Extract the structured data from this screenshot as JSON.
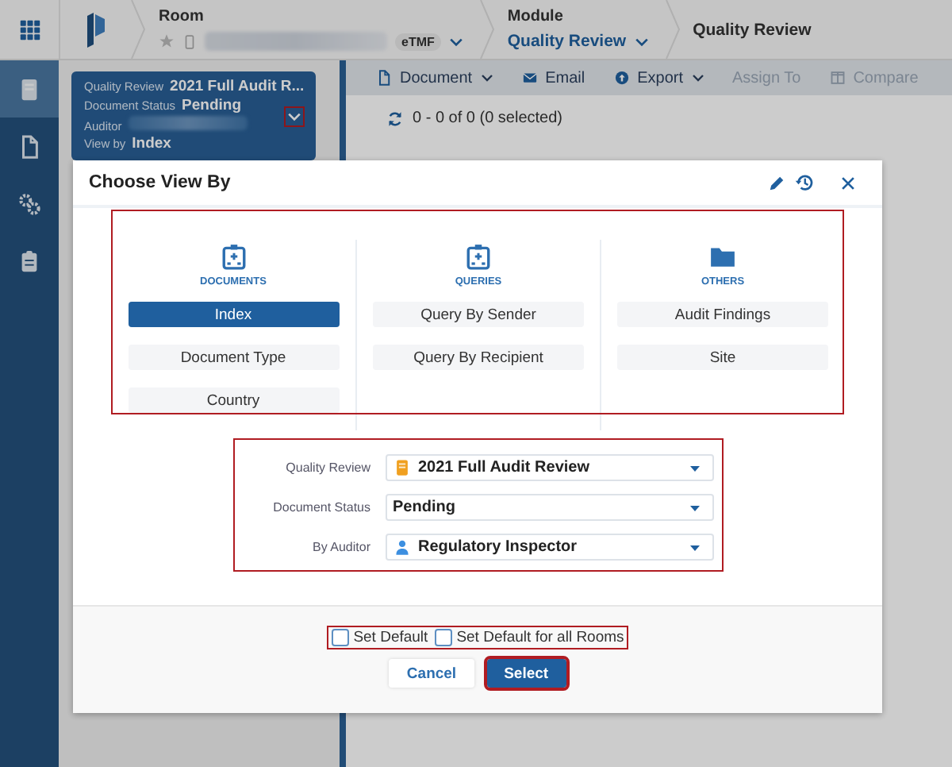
{
  "nav": {
    "room_label": "Room",
    "room_tag": "eTMF",
    "module_label": "Module",
    "module_value": "Quality Review",
    "page_title": "Quality Review"
  },
  "rail_items": [
    {
      "kind": "book",
      "selected": true
    },
    {
      "kind": "file",
      "selected": false
    },
    {
      "kind": "gears",
      "selected": false
    },
    {
      "kind": "clipboard",
      "selected": false
    }
  ],
  "summary": {
    "toggle_highlighted": true,
    "rows": [
      {
        "label": "Quality Review",
        "kind": "text",
        "value": "2021 Full Audit R..."
      },
      {
        "label": "Document Status",
        "kind": "text",
        "value": "Pending"
      },
      {
        "label": "Auditor",
        "kind": "redacted"
      },
      {
        "label": "View by",
        "kind": "text",
        "value": "Index"
      }
    ]
  },
  "toolbar": [
    {
      "label": "Document",
      "kind": "file",
      "dropdown": true,
      "disabled": false
    },
    {
      "label": "Email",
      "kind": "envelope",
      "dropdown": false,
      "disabled": false
    },
    {
      "label": "Export",
      "kind": "export",
      "dropdown": true,
      "disabled": false
    },
    {
      "label": "Assign To",
      "kind": "plain",
      "dropdown": false,
      "disabled": true
    },
    {
      "label": "Compare",
      "kind": "columns",
      "dropdown": false,
      "disabled": true
    }
  ],
  "count": "0 - 0 of 0 (0 selected)",
  "dialog": {
    "title": "Choose View By",
    "options_highlighted": true,
    "filters_highlighted": true,
    "defaults_highlighted": true,
    "groups": [
      {
        "heading": "DOCUMENTS",
        "kind": "building",
        "options": [
          {
            "label": "Index",
            "selected": true
          },
          {
            "label": "Document Type",
            "selected": false
          },
          {
            "label": "Country",
            "selected": false
          }
        ]
      },
      {
        "heading": "QUERIES",
        "kind": "building",
        "options": [
          {
            "label": "Query By Sender",
            "selected": false
          },
          {
            "label": "Query By Recipient",
            "selected": false
          }
        ]
      },
      {
        "heading": "OTHERS",
        "kind": "folder",
        "options": [
          {
            "label": "Audit Findings",
            "selected": false
          },
          {
            "label": "Site",
            "selected": false
          }
        ]
      }
    ],
    "filters": [
      {
        "label": "Quality Review",
        "value": "2021 Full Audit Review",
        "kind": "book"
      },
      {
        "label": "Document Status",
        "value": "Pending",
        "kind": "plain"
      },
      {
        "label": "By Auditor",
        "value": "Regulatory Inspector",
        "kind": "person"
      }
    ],
    "checkboxes": [
      {
        "label": "Set Default",
        "checked": false
      },
      {
        "label": "Set Default for all Rooms",
        "checked": false
      }
    ],
    "buttons": [
      {
        "label": "Cancel",
        "kind": "secondary",
        "highlighted": false
      },
      {
        "label": "Select",
        "kind": "primary",
        "highlighted": true
      }
    ]
  }
}
